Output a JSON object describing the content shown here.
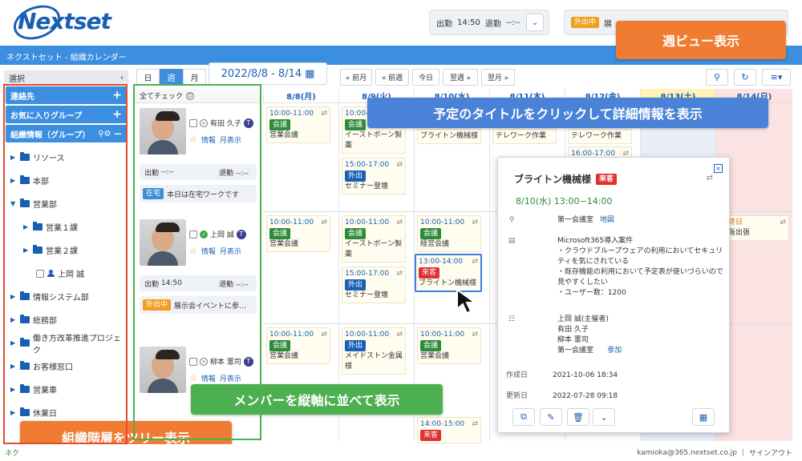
{
  "header": {
    "logo": "Nextset",
    "clock_in_label": "出勤",
    "clock_in_time": "14:50",
    "clock_out_label": "退勤",
    "clock_out_time": "--:--",
    "status_badge": "外出中",
    "status_text": "展"
  },
  "appbar": {
    "title": "ネクストセット - 組織カレンダー"
  },
  "sidebar": {
    "select_label": "選択",
    "contacts": "連絡先",
    "favorites": "お気に入りグループ",
    "org_info": "組織情報（グループ）",
    "tree": [
      {
        "label": "リソース",
        "level": 0,
        "type": "folder"
      },
      {
        "label": "本部",
        "level": 0,
        "type": "folder"
      },
      {
        "label": "営業部",
        "level": 0,
        "type": "folder-open"
      },
      {
        "label": "営業１課",
        "level": 1,
        "type": "folder"
      },
      {
        "label": "営業２課",
        "level": 1,
        "type": "folder"
      },
      {
        "label": "上岡 誠",
        "level": 2,
        "type": "person"
      },
      {
        "label": "情報システム部",
        "level": 0,
        "type": "folder"
      },
      {
        "label": "総務部",
        "level": 0,
        "type": "folder"
      },
      {
        "label": "働き方改革推進プロジェク",
        "level": 0,
        "type": "folder"
      },
      {
        "label": "お客様窓口",
        "level": 0,
        "type": "folder"
      },
      {
        "label": "営業車",
        "level": 0,
        "type": "folder"
      },
      {
        "label": "休業日",
        "level": 0,
        "type": "folder"
      }
    ]
  },
  "toolbar": {
    "view_day": "日",
    "view_week": "週",
    "view_month": "月",
    "date_range": "2022/8/8 - 8/14",
    "prev_month": "« 前月",
    "prev_week": "« 前週",
    "today": "今日",
    "next_week": "翌週 »",
    "next_month": "翌月 »"
  },
  "members": {
    "check_all": "全てチェック",
    "list": [
      {
        "name": "有田 久子",
        "info": "情報",
        "month": "月表示",
        "in_label": "出勤",
        "in": "--:--",
        "out_label": "退勤",
        "out": "--:--",
        "memo_badge": "在宅",
        "memo": "本日は在宅ワークです"
      },
      {
        "name": "上岡 誠",
        "info": "情報",
        "month": "月表示",
        "in_label": "出勤",
        "in": "14:50",
        "out_label": "退勤",
        "out": "--:--",
        "memo_badge": "外出中",
        "memo": "展示会イベントに参…"
      },
      {
        "name": "柳本 憲司",
        "info": "情報",
        "month": "月表示"
      }
    ]
  },
  "days": [
    "8/8(月)",
    "8/9(火)",
    "8/10(水)",
    "8/11(木)",
    "8/12(金)",
    "8/13(土)",
    "8/14(日)"
  ],
  "events": {
    "r1_d1": {
      "time": "10:00-11:00",
      "tag": "会議",
      "title": "営業会議"
    },
    "r1_d2a": {
      "time": "10:00-11:00",
      "tag": "会議",
      "title": "イーストボーン製薬"
    },
    "r1_d2b": {
      "time": "15:00-17:00",
      "tag": "外出",
      "title": "セミナー登壇"
    },
    "r1_d3": {
      "title": "ブライトン機械様"
    },
    "r1_d4": {
      "title": "テレワーク作業"
    },
    "r1_d5a": {
      "title": "テレワーク作業"
    },
    "r1_d5b": {
      "time": "16:00-17:00"
    },
    "r2_d1": {
      "time": "10:00-11:00",
      "tag": "会議",
      "title": "営業会議"
    },
    "r2_d2a": {
      "time": "10:00-11:00",
      "tag": "会議",
      "title": "イーストボーン製薬"
    },
    "r2_d2b": {
      "time": "15:00-17:00",
      "tag": "外出",
      "title": "セミナー登壇"
    },
    "r2_d3a": {
      "time": "10:00-11:00",
      "tag": "会議",
      "title": "経営会議"
    },
    "r2_d3b": {
      "time": "13:00-14:00",
      "tag": "来客",
      "title": "ブライトン機械様"
    },
    "r2_d7": {
      "time": "終日",
      "title": "阪出張"
    },
    "r3_d1": {
      "time": "10:00-11:00",
      "tag": "会議",
      "title": "営業会議"
    },
    "r3_d2": {
      "time": "10:00-11:00",
      "tag": "外出",
      "title": "メイドストン金属様"
    },
    "r3_d3a": {
      "time": "10:00-11:00",
      "tag": "会議",
      "title": "営業会議"
    },
    "r3_d3b": {
      "time": "14:00-15:00",
      "tag": "来客"
    }
  },
  "popup": {
    "title": "ブライトン機械様",
    "tag": "来客",
    "datetime": "8/10(水) 13:00−14:00",
    "place": "第一会議室",
    "map": "地図",
    "desc": [
      "Microsoft365導入案件",
      "・クラウドブループウェアの利用においてセキュリティを気にされている",
      "・既存機能の利用において予定表が使いづらいので見やすくしたい",
      "・ユーザー数：1200"
    ],
    "organizer": "上岡 誠(主催者)",
    "attendees": [
      "有田 久子",
      "柳本 憲司",
      "第一会議室"
    ],
    "join": "参加",
    "created_label": "作成日",
    "created": "2021-10-06 18:34",
    "updated_label": "更新日",
    "updated": "2022-07-28 09:18"
  },
  "callouts": {
    "week_view": "週ビュー表示",
    "click_title": "予定のタイトルをクリックして詳細情報を表示",
    "members_vertical": "メンバーを縦軸に並べて表示",
    "org_tree": "組織階層をツリー表示"
  },
  "footer": {
    "left": "ネク",
    "email": "kamioka@365.nextset.co.jp",
    "signout": "サインアウト"
  },
  "colors": {
    "brand": "#1a5fb4",
    "appbar": "#3c8fe0",
    "callout_orange": "#f07c33",
    "callout_blue": "#4a82d8",
    "callout_green": "#4caf50",
    "saturday": "#fff3b8",
    "sunday": "#fbe3e3"
  }
}
